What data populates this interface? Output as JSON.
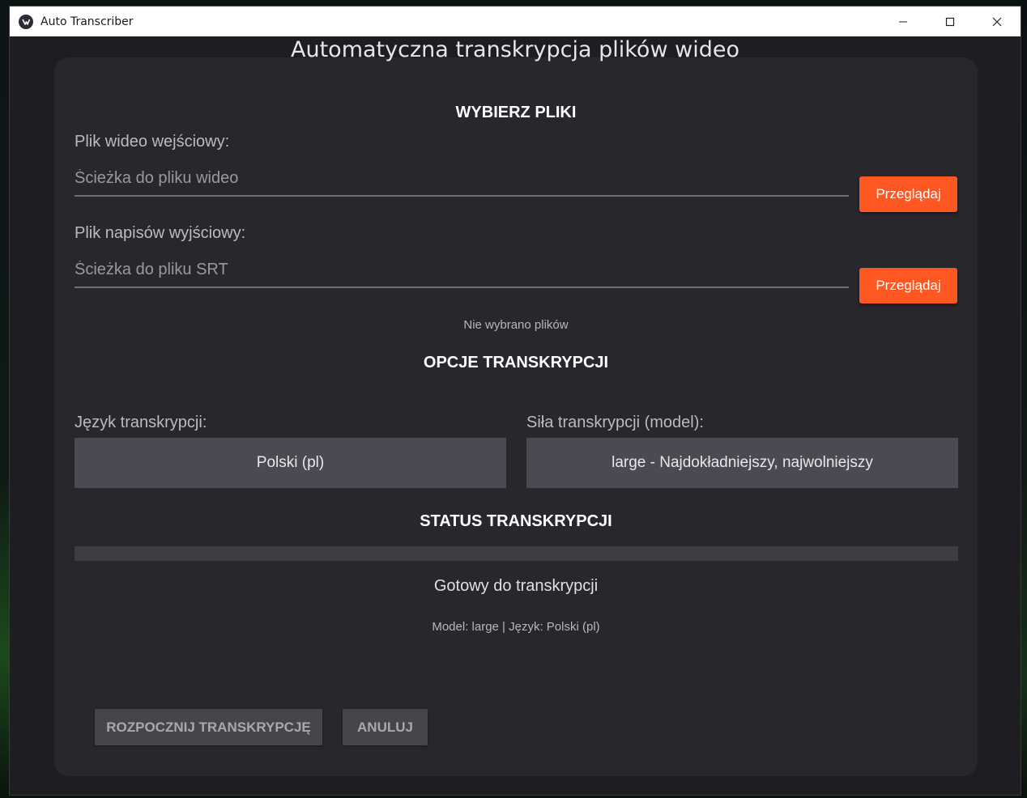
{
  "window": {
    "title": "Auto Transcriber",
    "controls": [
      "minimize-icon",
      "maximize-icon",
      "close-icon"
    ]
  },
  "header": {
    "title": "Automatyczna transkrypcja plików wideo"
  },
  "files_section": {
    "title": "WYBIERZ PLIKI",
    "video_label": "Plik wideo wejściowy:",
    "video_placeholder": "Ścieżka do pliku wideo",
    "video_value": "",
    "video_browse": "Przeglądaj",
    "srt_label": "Plik napisów wyjściowy:",
    "srt_placeholder": "Ścieżka do pliku SRT",
    "srt_value": "",
    "srt_browse": "Przeglądaj",
    "selection_note": "Nie wybrano plików"
  },
  "options_section": {
    "title": "OPCJE TRANSKRYPCJI",
    "language_label": "Język transkrypcji:",
    "language_value": "Polski (pl)",
    "model_label": "Siła transkrypcji (model):",
    "model_value": "large - Najdokładniejszy, najwolniejszy"
  },
  "status_section": {
    "title": "STATUS TRANSKRYPCJI",
    "progress": 0,
    "status_text": "Gotowy do transkrypcji",
    "details": "Model: large | Język: Polski (pl)"
  },
  "actions": {
    "start": "ROZPOCZNIJ TRANSKRYPCJĘ",
    "cancel": "ANULUJ"
  },
  "colors": {
    "accent": "#ff5722",
    "card_bg": "#27272c",
    "window_bg": "#1e1e22",
    "select_bg": "#4a4a53"
  }
}
